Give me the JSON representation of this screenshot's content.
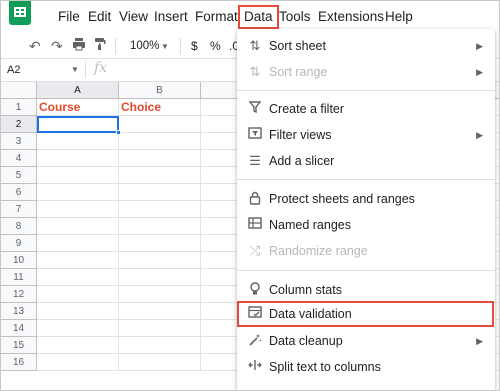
{
  "menubar": {
    "items": [
      {
        "label": "File"
      },
      {
        "label": "Edit"
      },
      {
        "label": "View"
      },
      {
        "label": "Insert"
      },
      {
        "label": "Format"
      },
      {
        "label": "Data"
      },
      {
        "label": "Tools"
      },
      {
        "label": "Extensions"
      },
      {
        "label": "Help"
      }
    ]
  },
  "toolbar": {
    "zoom": "100%",
    "currency": "$",
    "percent": "%",
    "decimal": ".0"
  },
  "formula_bar": {
    "name_box": "A2",
    "fx": "fx"
  },
  "grid": {
    "columns": [
      "A",
      "B"
    ],
    "rows": [
      "1",
      "2",
      "3",
      "4",
      "5",
      "6",
      "7",
      "8",
      "9",
      "10",
      "11",
      "12",
      "13",
      "14",
      "15",
      "16"
    ],
    "cells": {
      "A1": "Course",
      "B1": "Choice"
    }
  },
  "data_menu": {
    "items": [
      {
        "label": "Sort sheet",
        "icon": "sort-icon",
        "submenu": true,
        "disabled": false
      },
      {
        "label": "Sort range",
        "icon": "sort-icon",
        "submenu": true,
        "disabled": true
      },
      {
        "label": "Create a filter",
        "icon": "filter-icon",
        "submenu": false,
        "disabled": false
      },
      {
        "label": "Filter views",
        "icon": "filter-views-icon",
        "submenu": true,
        "disabled": false
      },
      {
        "label": "Add a slicer",
        "icon": "slicer-icon",
        "submenu": false,
        "disabled": false
      },
      {
        "label": "Protect sheets and ranges",
        "icon": "lock-icon",
        "submenu": false,
        "disabled": false
      },
      {
        "label": "Named ranges",
        "icon": "named-ranges-icon",
        "submenu": false,
        "disabled": false
      },
      {
        "label": "Randomize range",
        "icon": "shuffle-icon",
        "submenu": false,
        "disabled": true
      },
      {
        "label": "Column stats",
        "icon": "lightbulb-icon",
        "submenu": false,
        "disabled": false
      },
      {
        "label": "Data validation",
        "icon": "data-validation-icon",
        "submenu": false,
        "disabled": false
      },
      {
        "label": "Data cleanup",
        "icon": "magic-wand-icon",
        "submenu": true,
        "disabled": false
      },
      {
        "label": "Split text to columns",
        "icon": "split-columns-icon",
        "submenu": false,
        "disabled": false
      }
    ]
  },
  "colors": {
    "highlight_border": "#e34b3b",
    "header_text": "#e34b2b",
    "selection": "#1a73e8",
    "sheets_green": "#0f9d58"
  }
}
